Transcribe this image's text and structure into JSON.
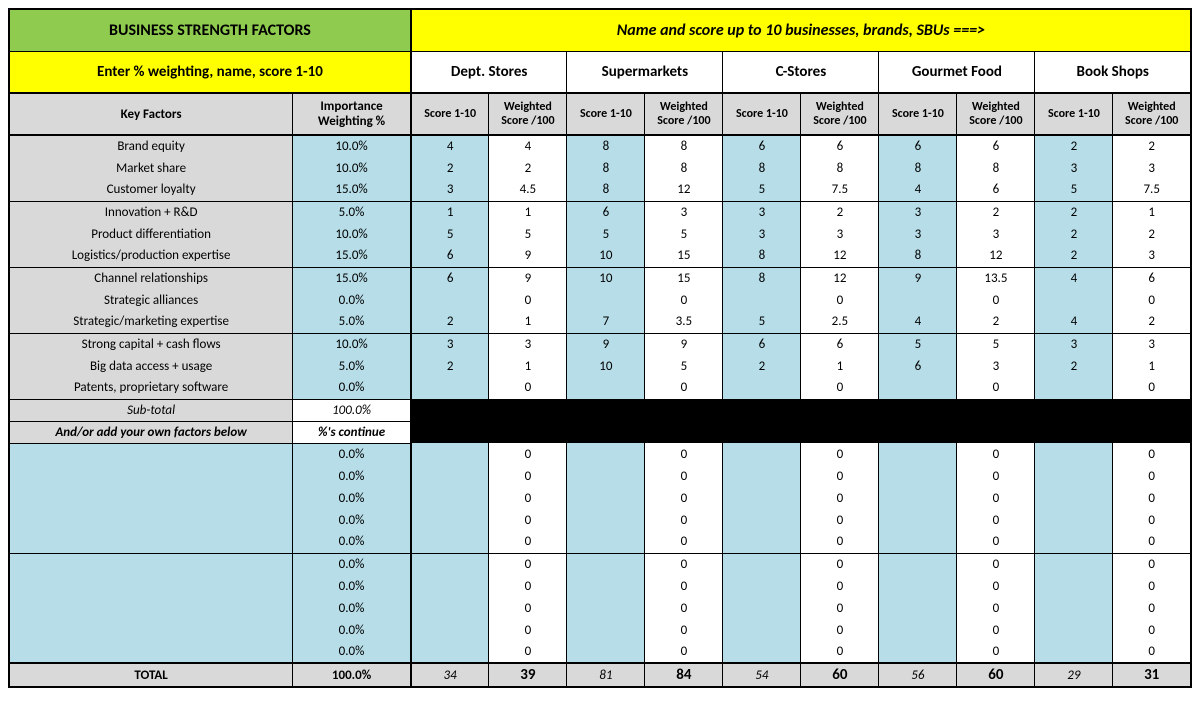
{
  "header": {
    "title_left": "BUSINESS STRENGTH FACTORS",
    "title_right": "Name and score up to 10 businesses, brands, SBUs ===>",
    "subtitle_left": "Enter % weighting, name, score 1-10"
  },
  "columns": {
    "key_factors": "Key Factors",
    "weight": "Importance Weighting %",
    "score": "Score 1-10",
    "wscore": "Weighted Score /100"
  },
  "businesses": [
    "Dept. Stores",
    "Supermarkets",
    "C-Stores",
    "Gourmet Food",
    "Book Shops"
  ],
  "factors": [
    {
      "name": "Brand equity",
      "weight": "10.0%",
      "scores": [
        "4",
        "8",
        "6",
        "6",
        "2"
      ],
      "wscores": [
        "4",
        "8",
        "6",
        "6",
        "2"
      ]
    },
    {
      "name": "Market share",
      "weight": "10.0%",
      "scores": [
        "2",
        "8",
        "8",
        "8",
        "3"
      ],
      "wscores": [
        "2",
        "8",
        "8",
        "8",
        "3"
      ]
    },
    {
      "name": "Customer loyalty",
      "weight": "15.0%",
      "scores": [
        "3",
        "8",
        "5",
        "4",
        "5"
      ],
      "wscores": [
        "4.5",
        "12",
        "7.5",
        "6",
        "7.5"
      ]
    },
    {
      "name": "Innovation + R&D",
      "weight": "5.0%",
      "scores": [
        "1",
        "6",
        "3",
        "3",
        "2"
      ],
      "wscores": [
        "1",
        "3",
        "2",
        "2",
        "1"
      ]
    },
    {
      "name": "Product differentiation",
      "weight": "10.0%",
      "scores": [
        "5",
        "5",
        "3",
        "3",
        "2"
      ],
      "wscores": [
        "5",
        "5",
        "3",
        "3",
        "2"
      ]
    },
    {
      "name": "Logistics/production expertise",
      "weight": "15.0%",
      "scores": [
        "6",
        "10",
        "8",
        "8",
        "2"
      ],
      "wscores": [
        "9",
        "15",
        "12",
        "12",
        "3"
      ]
    },
    {
      "name": "Channel relationships",
      "weight": "15.0%",
      "scores": [
        "6",
        "10",
        "8",
        "9",
        "4"
      ],
      "wscores": [
        "9",
        "15",
        "12",
        "13.5",
        "6"
      ]
    },
    {
      "name": "Strategic alliances",
      "weight": "0.0%",
      "scores": [
        "",
        "",
        "",
        "",
        ""
      ],
      "wscores": [
        "0",
        "0",
        "0",
        "0",
        "0"
      ]
    },
    {
      "name": "Strategic/marketing expertise",
      "weight": "5.0%",
      "scores": [
        "2",
        "7",
        "5",
        "4",
        "4"
      ],
      "wscores": [
        "1",
        "3.5",
        "2.5",
        "2",
        "2"
      ]
    },
    {
      "name": "Strong capital + cash flows",
      "weight": "10.0%",
      "scores": [
        "3",
        "9",
        "6",
        "5",
        "3"
      ],
      "wscores": [
        "3",
        "9",
        "6",
        "5",
        "3"
      ]
    },
    {
      "name": "Big data access + usage",
      "weight": "5.0%",
      "scores": [
        "2",
        "10",
        "2",
        "6",
        "2"
      ],
      "wscores": [
        "1",
        "5",
        "1",
        "3",
        "1"
      ]
    },
    {
      "name": "Patents, proprietary software",
      "weight": "0.0%",
      "scores": [
        "",
        "",
        "",
        "",
        ""
      ],
      "wscores": [
        "0",
        "0",
        "0",
        "0",
        "0"
      ]
    }
  ],
  "subtotal": {
    "label": "Sub-total",
    "weight": "100.0%"
  },
  "custom_header": {
    "label": "And/or add your own factors below",
    "weight": "%'s continue"
  },
  "custom_rows_count": 10,
  "custom_weight": "0.0%",
  "custom_wscore": "0",
  "total": {
    "label": "TOTAL",
    "weight": "100.0%",
    "scores": [
      "34",
      "81",
      "54",
      "56",
      "29"
    ],
    "wscores": [
      "39",
      "84",
      "60",
      "60",
      "31"
    ]
  },
  "groups": [
    3,
    3,
    3,
    3
  ]
}
